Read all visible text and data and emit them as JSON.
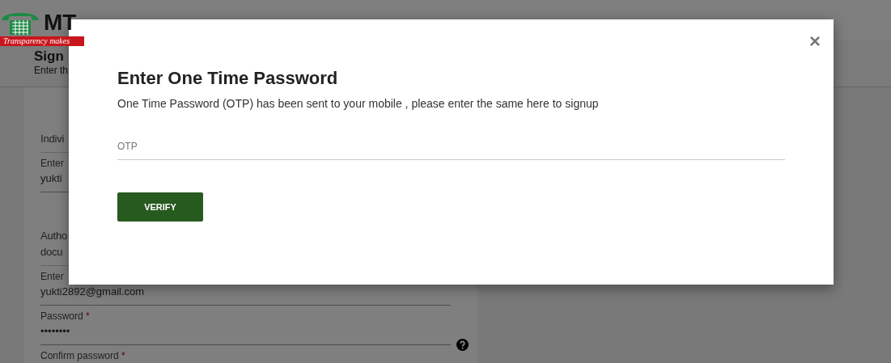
{
  "header": {
    "logo_text": "MT",
    "tagline": "Transparency makes"
  },
  "page": {
    "title": "Sign",
    "subtitle": "Enter th"
  },
  "form": [
    {
      "kind": "heading",
      "lines": [
        "Indivi"
      ]
    },
    {
      "kind": "field",
      "label": "Enter",
      "value": "yukti"
    },
    {
      "kind": "heading",
      "lines": [
        "Autho",
        "docu"
      ]
    },
    {
      "kind": "field",
      "label": "Enter",
      "value": "yukti2892@gmail.com"
    },
    {
      "kind": "field",
      "label": "Password",
      "required_mark": "*",
      "value": "••••••••",
      "help": true
    },
    {
      "kind": "field",
      "label": "Confirm password",
      "required_mark": "*"
    }
  ],
  "modal": {
    "title": "Enter One Time Password",
    "message": "One Time Password (OTP) has been sent to your mobile , please enter the same here to signup",
    "otp_placeholder": "OTP",
    "verify_label": "VERIFY",
    "close": "×"
  }
}
